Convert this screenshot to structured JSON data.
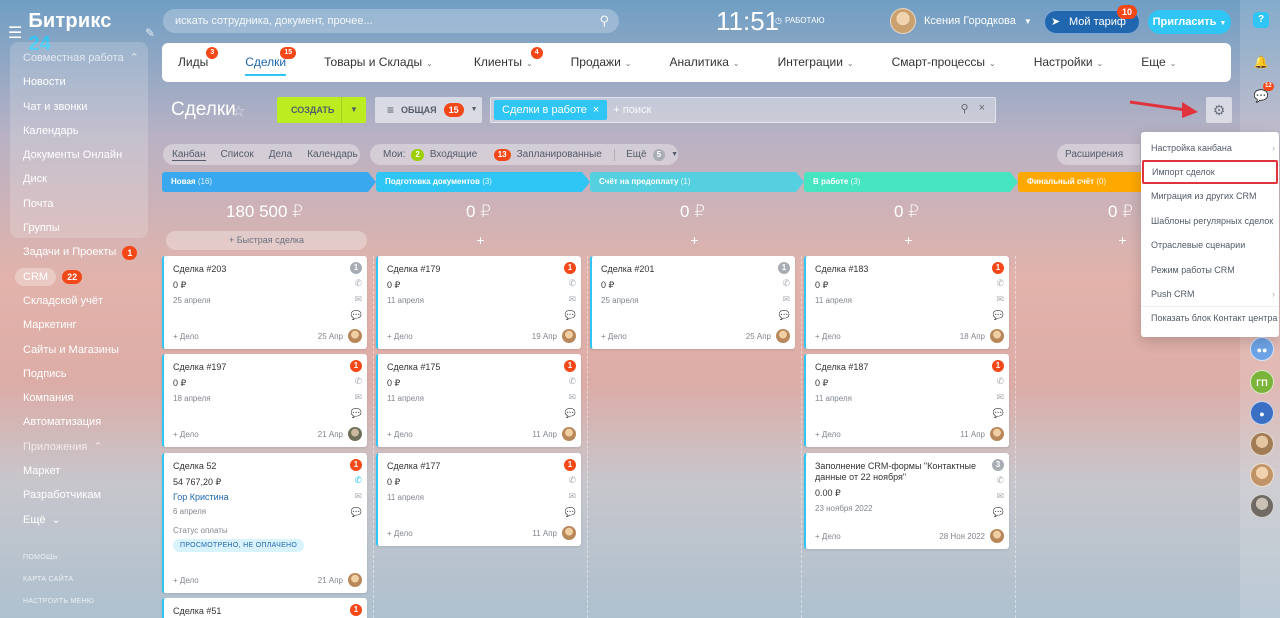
{
  "app": {
    "name": "Битрикс",
    "name_accent": "24"
  },
  "search": {
    "placeholder": "искать сотрудника, документ, прочее..."
  },
  "clock": {
    "time": "11:51",
    "status": "РАБОТАЮ"
  },
  "user": {
    "name": "Ксения Городкова"
  },
  "tariff": {
    "label": "Мой тариф",
    "badge": "10"
  },
  "invite": {
    "label": "Пригласить"
  },
  "sidebar": {
    "items": [
      {
        "label": "Совместная работа",
        "group": true
      },
      {
        "label": "Новости"
      },
      {
        "label": "Чат и звонки"
      },
      {
        "label": "Календарь"
      },
      {
        "label": "Документы Онлайн"
      },
      {
        "label": "Диск"
      },
      {
        "label": "Почта"
      },
      {
        "label": "Группы"
      },
      {
        "label": "Задачи и Проекты",
        "badge": "1"
      },
      {
        "label": "CRM",
        "badge": "22",
        "active": true
      },
      {
        "label": "Складской учёт"
      },
      {
        "label": "Маркетинг"
      },
      {
        "label": "Сайты и Магазины"
      },
      {
        "label": "Подпись"
      },
      {
        "label": "Компания"
      },
      {
        "label": "Автоматизация"
      },
      {
        "label": "Приложения",
        "group": true
      },
      {
        "label": "Маркет"
      },
      {
        "label": "Разработчикам"
      },
      {
        "label": "Ещё"
      }
    ],
    "footer": [
      "ПОМОЩЬ",
      "КАРТА САЙТА",
      "НАСТРОИТЬ МЕНЮ"
    ]
  },
  "rail": {
    "help": "?",
    "chat_badge": "12",
    "avatar_initials": "ГП"
  },
  "topnav": {
    "tabs": [
      {
        "label": "Лиды",
        "badge": "3"
      },
      {
        "label": "Сделки",
        "badge": "15",
        "active": true
      },
      {
        "label": "Товары и Склады",
        "dropdown": true
      },
      {
        "label": "Клиенты",
        "badge": "4",
        "dropdown": true
      },
      {
        "label": "Продажи",
        "dropdown": true
      },
      {
        "label": "Аналитика",
        "dropdown": true
      },
      {
        "label": "Интеграции",
        "dropdown": true
      },
      {
        "label": "Смарт-процессы",
        "dropdown": true
      },
      {
        "label": "Настройки",
        "dropdown": true
      },
      {
        "label": "Еще",
        "dropdown": true
      }
    ]
  },
  "toolbar": {
    "title": "Сделки",
    "create_label": "СОЗДАТЬ",
    "preset_label": "ОБЩАЯ",
    "preset_badge": "15",
    "filter_chip": "Сделки в работе",
    "filter_placeholder": "+ поиск"
  },
  "views": [
    "Канбан",
    "Список",
    "Дела",
    "Календарь"
  ],
  "counters": {
    "mine_label": "Мои:",
    "incoming_count": "2",
    "incoming_label": "Входящие",
    "planned_count": "13",
    "planned_label": "Запланированные",
    "more_label": "Ещё",
    "more_count": "5"
  },
  "expand_label": "Расширения",
  "columns": [
    {
      "title": "Новая",
      "count": "(16)",
      "color": "#39a8ef",
      "sum": "180 500 ₽",
      "add_label": "+ Быстрая сделка",
      "cards": [
        {
          "name": "Сделка #203",
          "amount": "0 ₽",
          "date": "25 апреля",
          "badge": "1",
          "badge_color": "grey",
          "add": "+ Дело",
          "footer_date": "25 Апр"
        },
        {
          "name": "Сделка #197",
          "amount": "0 ₽",
          "date": "18 апреля",
          "badge": "1",
          "badge_color": "red",
          "add": "+ Дело",
          "footer_date": "21 Апр"
        },
        {
          "name": "Сделка 52",
          "amount": "54 767,20 ₽",
          "contact": "Гор Кристина",
          "date": "6 апреля",
          "status_title": "Статус оплаты",
          "status": "ПРОСМОТРЕНО, НЕ ОПЛАЧЕНО",
          "badge": "1",
          "badge_color": "red",
          "add": "+ Дело",
          "footer_date": "21 Апр"
        },
        {
          "name": "Сделка #51",
          "badge": "1",
          "badge_color": "red"
        }
      ]
    },
    {
      "title": "Подготовка документов",
      "count": "(3)",
      "color": "#2fc6f6",
      "sum": "0 ₽",
      "add_label": "+",
      "cards": [
        {
          "name": "Сделка #179",
          "amount": "0 ₽",
          "date": "11 апреля",
          "badge": "1",
          "badge_color": "red",
          "add": "+ Дело",
          "footer_date": "19 Апр"
        },
        {
          "name": "Сделка #175",
          "amount": "0 ₽",
          "date": "11 апреля",
          "badge": "1",
          "badge_color": "red",
          "add": "+ Дело",
          "footer_date": "11 Апр"
        },
        {
          "name": "Сделка #177",
          "amount": "0 ₽",
          "date": "11 апреля",
          "badge": "1",
          "badge_color": "red",
          "add": "+ Дело",
          "footer_date": "11 Апр"
        }
      ]
    },
    {
      "title": "Счёт на предоплату",
      "count": "(1)",
      "color": "#55d0e0",
      "sum": "0 ₽",
      "add_label": "+",
      "cards": [
        {
          "name": "Сделка #201",
          "amount": "0 ₽",
          "date": "25 апреля",
          "badge": "1",
          "badge_color": "grey",
          "add": "+ Дело",
          "footer_date": "25 Апр"
        }
      ]
    },
    {
      "title": "В работе",
      "count": "(3)",
      "color": "#47e4c2",
      "sum": "0 ₽",
      "add_label": "+",
      "cards": [
        {
          "name": "Сделка #183",
          "amount": "0 ₽",
          "date": "11 апреля",
          "badge": "1",
          "badge_color": "red",
          "add": "+ Дело",
          "footer_date": "18 Апр"
        },
        {
          "name": "Сделка #187",
          "amount": "0 ₽",
          "date": "11 апреля",
          "badge": "1",
          "badge_color": "red",
          "add": "+ Дело",
          "footer_date": "11 Апр"
        },
        {
          "name": "Заполнение CRM-формы \"Контактные данные от 22 ноября\"",
          "amount": "0.00 ₽",
          "date": "23 ноября 2022",
          "badge": "3",
          "badge_color": "grey",
          "add": "+ Дело",
          "footer_date": "28 Ноя 2022"
        }
      ]
    },
    {
      "title": "Финальный счёт",
      "count": "(0)",
      "color": "#ffa900",
      "sum": "0 ₽",
      "add_label": "+",
      "cards": []
    }
  ],
  "settings_menu": {
    "items": [
      {
        "label": "Настройка канбана",
        "submenu": true
      },
      {
        "label": "Импорт сделок",
        "highlighted": true
      },
      {
        "label": "Миграция из других CRM"
      },
      {
        "label": "Шаблоны регулярных сделок"
      },
      {
        "label": "Отраслевые сценарии"
      },
      {
        "label": "Режим работы CRM"
      },
      {
        "label": "Push CRM",
        "submenu": true
      },
      {
        "label": "Показать блок Контакт центра"
      }
    ]
  },
  "colors": {
    "accent": "#2fc6f6",
    "create_button": "#bbed21",
    "badge": "#f54819",
    "highlight_border": "#e0333b",
    "arrow": "#e0333b"
  },
  "icons": {
    "menu": "burger-icon",
    "search": "search-icon",
    "settings": "gear-icon",
    "notifications": "bell-icon",
    "phone": "phone-icon",
    "mail": "mail-icon",
    "chat": "chat-icon"
  }
}
